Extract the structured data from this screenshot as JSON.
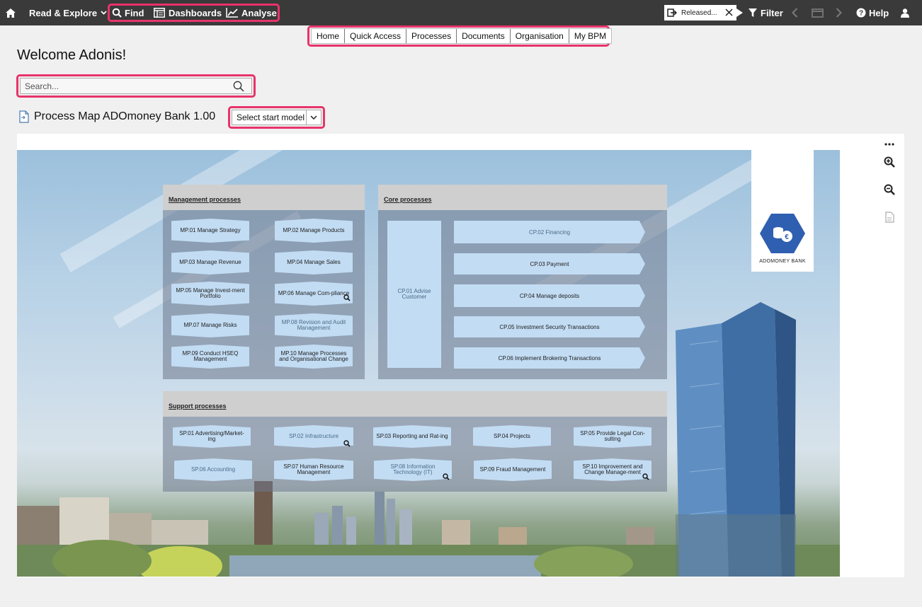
{
  "topbar": {
    "home_icon": "home-icon",
    "read_explore": "Read & Explore",
    "find": "Find",
    "dashboards": "Dashboards",
    "analyse": "Analyse",
    "released": "Released...",
    "filter": "Filter",
    "help": "Help"
  },
  "subnav": [
    "Home",
    "Quick Access",
    "Processes",
    "Documents",
    "Organisation",
    "My BPM"
  ],
  "welcome": "Welcome Adonis!",
  "search": {
    "placeholder": "Search..."
  },
  "process_map": {
    "title": "Process Map ADOmoney Bank 1.00",
    "select_label": "Select start model"
  },
  "map": {
    "management_title": "Management processes",
    "core_title": "Core processes",
    "support_title": "Support processes",
    "management": [
      "MP.01 Manage Strategy",
      "MP.02 Manage Products",
      "MP.03 Manage Revenue",
      "MP.04 Manage Sales",
      "MP.05 Manage Invest-ment Portfolio",
      "MP.06 Manage Com-pliance",
      "MP.07 Manage Risks",
      "MP.08 Revision and Audit Management",
      "MP.09 Conduct HSEQ Management",
      "MP.10 Manage Processes and Organisational Change"
    ],
    "core_advise": "CP.01 Advise Customer",
    "core": [
      "CP.02 Financing",
      "CP.03 Payment",
      "CP.04 Manage deposits",
      "CP.05 Investment Security Transactions",
      "CP.06 Implement Brokering Transactions"
    ],
    "support": [
      "SP.01 Advertising/Market-ing",
      "SP.02 Infrastructure",
      "SP.03 Reporting and Rat-ing",
      "SP.04 Projects",
      "SP.05 Provide Legal Con-sulting",
      "SP.06 Accounting",
      "SP.07 Human Resource Management",
      "SP.08 Information Technology (IT)",
      "SP.09 Fraud Management",
      "SP.10 Improvement and Change Manage-ment"
    ],
    "logo_text": "ADOMONEY BANK"
  },
  "colors": {
    "highlight": "#e8336a",
    "topbar": "#3a3a3a",
    "process_fill": "#c2dcf3",
    "logo_blue": "#2f5fb0"
  }
}
